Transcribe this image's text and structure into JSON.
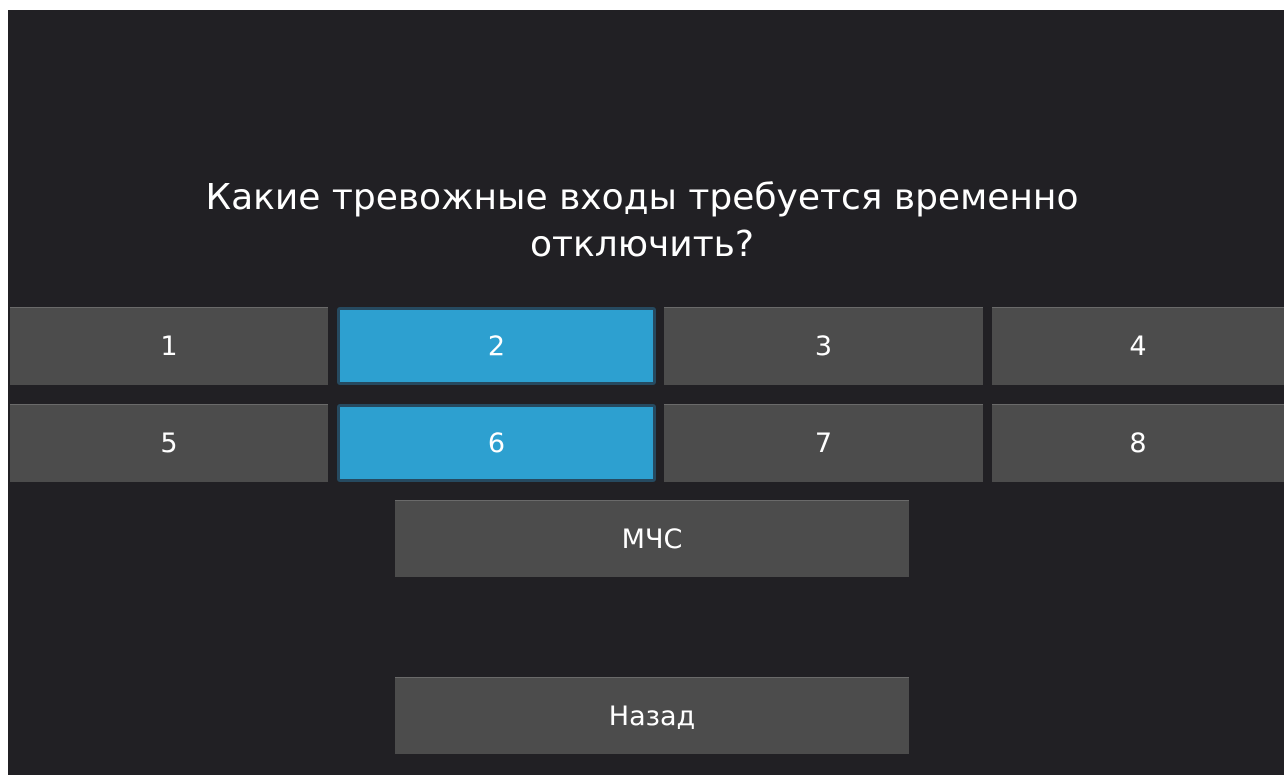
{
  "question": {
    "line1": "Какие тревожные входы требуется временно",
    "line2": "отключить?"
  },
  "inputs": [
    {
      "label": "1",
      "selected": false
    },
    {
      "label": "2",
      "selected": true
    },
    {
      "label": "3",
      "selected": false
    },
    {
      "label": "4",
      "selected": false
    },
    {
      "label": "5",
      "selected": false
    },
    {
      "label": "6",
      "selected": true
    },
    {
      "label": "7",
      "selected": false
    },
    {
      "label": "8",
      "selected": false
    }
  ],
  "actions": {
    "mchs_label": "МЧС",
    "back_label": "Назад"
  },
  "colors": {
    "background": "#212024",
    "button": "#4c4c4c",
    "selected": "#2da0d0",
    "text": "#ffffff"
  }
}
